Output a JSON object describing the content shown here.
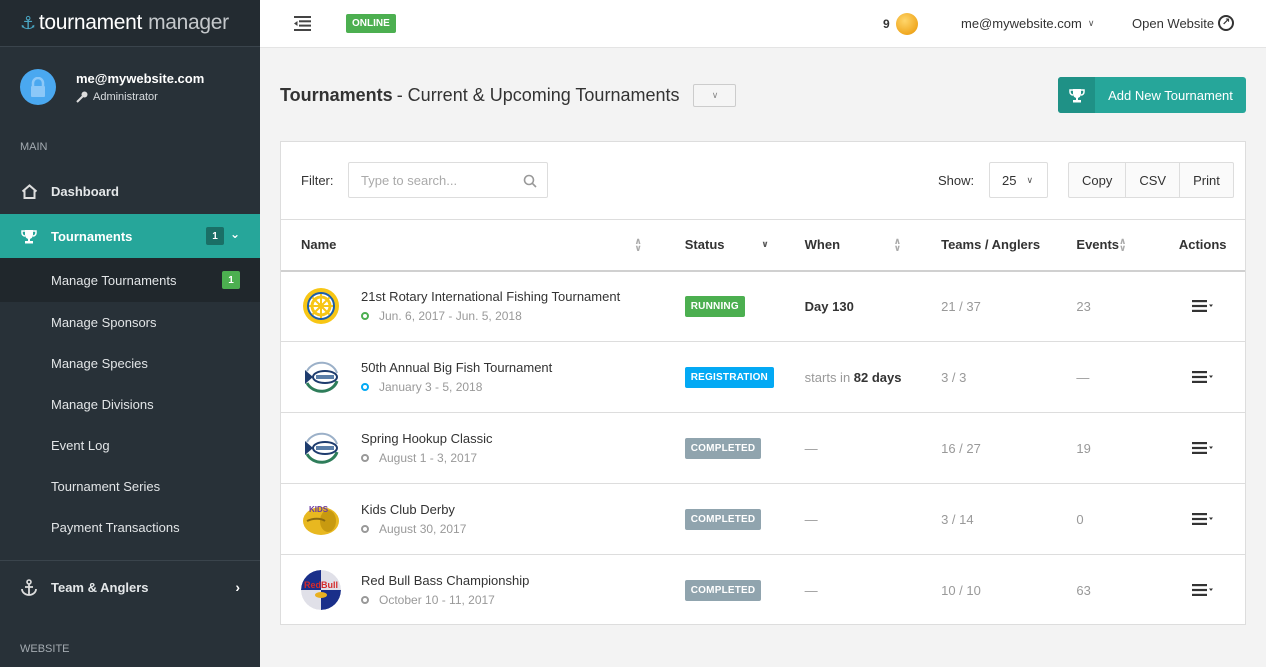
{
  "app": {
    "logo_part1": "tournament",
    "logo_part2": "manager"
  },
  "user": {
    "email": "me@mywebsite.com",
    "role": "Administrator"
  },
  "sidebar": {
    "section_main": "MAIN",
    "section_website": "WEBSITE",
    "dashboard": "Dashboard",
    "tournaments": "Tournaments",
    "tournaments_badge": "1",
    "submenu": [
      {
        "label": "Manage Tournaments",
        "badge": "1"
      },
      {
        "label": "Manage Sponsors"
      },
      {
        "label": "Manage Species"
      },
      {
        "label": "Manage Divisions"
      },
      {
        "label": "Event Log"
      },
      {
        "label": "Tournament Series"
      },
      {
        "label": "Payment Transactions"
      }
    ],
    "team_anglers": "Team & Anglers"
  },
  "topbar": {
    "status": "ONLINE",
    "coins": "9",
    "account": "me@mywebsite.com",
    "open_website": "Open Website"
  },
  "page": {
    "title_bold": "Tournaments",
    "title_sub": "- Current & Upcoming Tournaments",
    "add_button": "Add New Tournament"
  },
  "toolbar": {
    "filter_label": "Filter:",
    "search_placeholder": "Type to search...",
    "search_value": "",
    "show_label": "Show:",
    "show_value": "25",
    "copy": "Copy",
    "csv": "CSV",
    "print": "Print"
  },
  "table": {
    "columns": [
      "Name",
      "Status",
      "When",
      "Teams / Anglers",
      "Events",
      "Actions"
    ],
    "rows": [
      {
        "name": "21st Rotary International Fishing Tournament",
        "dates": "Jun. 6, 2017 - Jun. 5, 2018",
        "status": "RUNNING",
        "when_prefix": "",
        "when_bold": "Day 130",
        "teams": "21 / 37",
        "events": "23"
      },
      {
        "name": "50th Annual Big Fish Tournament",
        "dates": "January 3 - 5, 2018",
        "status": "REGISTRATION",
        "when_prefix": "starts in ",
        "when_bold": "82 days",
        "teams": "3 / 3",
        "events": "—"
      },
      {
        "name": "Spring Hookup Classic",
        "dates": "August 1 - 3, 2017",
        "status": "COMPLETED",
        "when_prefix": "—",
        "when_bold": "",
        "teams": "16 / 27",
        "events": "19"
      },
      {
        "name": "Kids Club Derby",
        "dates": "August 30, 2017",
        "status": "COMPLETED",
        "when_prefix": "—",
        "when_bold": "",
        "teams": "3 / 14",
        "events": "0"
      },
      {
        "name": "Red Bull Bass Championship",
        "dates": "October 10 - 11, 2017",
        "status": "COMPLETED",
        "when_prefix": "—",
        "when_bold": "",
        "teams": "10 / 10",
        "events": "63"
      }
    ]
  },
  "colors": {
    "accent": "#26a69a",
    "running": "#4caf50",
    "registration": "#03a9f4",
    "completed": "#90a4ae",
    "sidebar_bg": "#283138"
  }
}
